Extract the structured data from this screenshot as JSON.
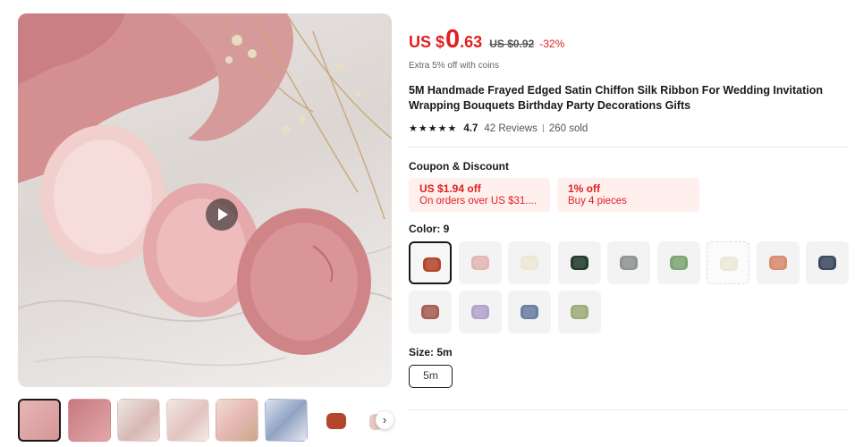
{
  "price": {
    "currency": "US $",
    "integer": "0",
    "decimal": ".63",
    "original": "US $0.92",
    "discount": "-32%",
    "coins_note": "Extra 5% off with coins"
  },
  "product": {
    "title": "5M Handmade Frayed Edged Satin Chiffon Silk Ribbon For Wedding Invitation Wrapping Bouquets Birthday Party Decorations Gifts",
    "stars": [
      "★",
      "★",
      "★",
      "★",
      "★"
    ],
    "rating": "4.7",
    "reviews": "42 Reviews",
    "sold": "260 sold"
  },
  "coupons": {
    "label": "Coupon & Discount",
    "items": [
      {
        "main": "US $1.94 off",
        "sub": "On orders over US $31...."
      },
      {
        "main": "1% off",
        "sub": "Buy 4 pieces"
      }
    ]
  },
  "color": {
    "label": "Color: 9",
    "swatches": [
      {
        "name": "rust",
        "hex": "#b5462e"
      },
      {
        "name": "blush",
        "hex": "#e3b6b3"
      },
      {
        "name": "ivory",
        "hex": "#ece6d4"
      },
      {
        "name": "dark-green",
        "hex": "#233a2c"
      },
      {
        "name": "grey",
        "hex": "#8f9590"
      },
      {
        "name": "sage-green",
        "hex": "#7fa574"
      },
      {
        "name": "cream",
        "hex": "#ece8d8"
      },
      {
        "name": "peach",
        "hex": "#d98c6f"
      },
      {
        "name": "navy",
        "hex": "#3d4a5f"
      },
      {
        "name": "terracotta",
        "hex": "#a85e52"
      },
      {
        "name": "lavender",
        "hex": "#b4a2cc"
      },
      {
        "name": "dusty-blue",
        "hex": "#6a7fa0"
      },
      {
        "name": "olive",
        "hex": "#9dac7a"
      }
    ]
  },
  "size": {
    "label": "Size: 5m",
    "options": [
      "5m"
    ]
  },
  "gallery": {
    "next_arrow": "›"
  }
}
